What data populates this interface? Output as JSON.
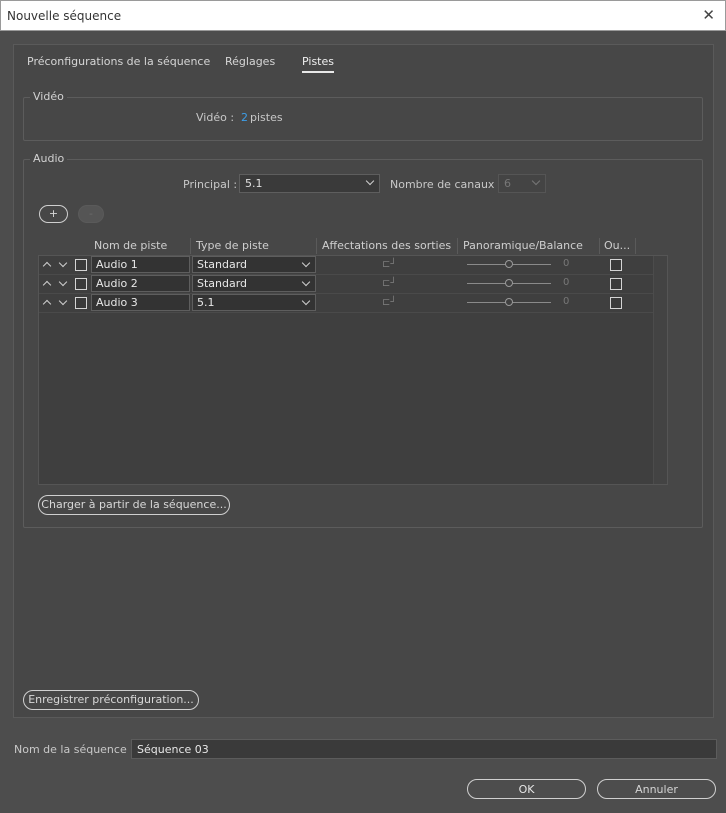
{
  "window": {
    "title": "Nouvelle séquence",
    "close": "✕"
  },
  "tabs": [
    {
      "label": "Préconfigurations de la séquence"
    },
    {
      "label": "Réglages"
    },
    {
      "label": "Pistes"
    }
  ],
  "video": {
    "group_title": "Vidéo",
    "label": "Vidéo :",
    "count": "2",
    "unit": "pistes"
  },
  "audio": {
    "group_title": "Audio",
    "principal_label": "Principal :",
    "principal_value": "5.1",
    "channels_label": "Nombre de canaux :",
    "channels_value": "6",
    "add_label": "+",
    "remove_label": "-",
    "columns": [
      "Nom de piste",
      "Type de piste",
      "Affectations des sorties",
      "Panoramique/Balance",
      "Ou..."
    ],
    "tracks": [
      {
        "name": "Audio 1",
        "type": "Standard",
        "pan": "0"
      },
      {
        "name": "Audio 2",
        "type": "Standard",
        "pan": "0"
      },
      {
        "name": "Audio 3",
        "type": "5.1",
        "pan": "0"
      }
    ],
    "load_button": "Charger à partir de la séquence..."
  },
  "save_preset_button": "Enregistrer préconfiguration...",
  "sequence_name": {
    "label": "Nom de la séquence :",
    "value": "Séquence 03"
  },
  "buttons": {
    "ok": "OK",
    "cancel": "Annuler"
  }
}
